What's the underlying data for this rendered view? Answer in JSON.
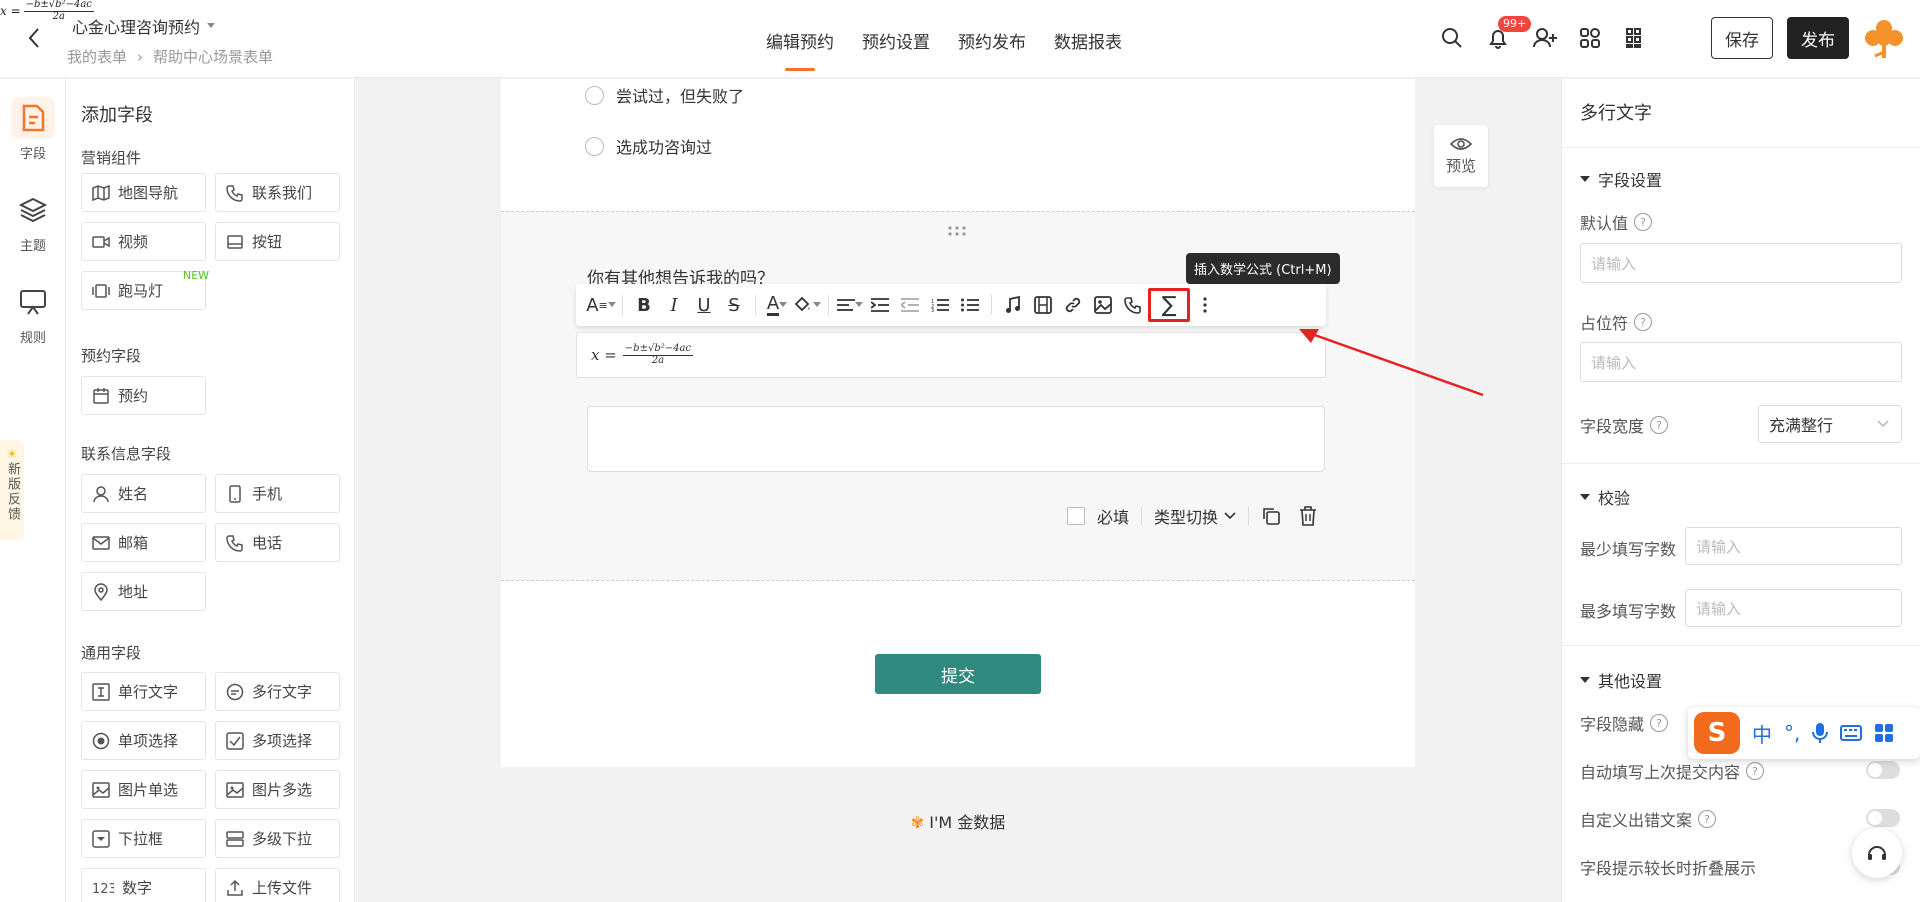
{
  "header": {
    "formula": {
      "lhs": "x =",
      "num": "−b±√b²−4ac",
      "den": "2a"
    },
    "title": "心金心理咨询预约",
    "breadcrumb": [
      "我的表单",
      "帮助中心场景表单"
    ],
    "tabs": [
      {
        "label": "编辑预约",
        "active": true
      },
      {
        "label": "预约设置",
        "active": false
      },
      {
        "label": "预约发布",
        "active": false
      },
      {
        "label": "数据报表",
        "active": false
      }
    ],
    "notification_badge": "99+",
    "save_label": "保存",
    "publish_label": "发布"
  },
  "rail": {
    "items": [
      {
        "label": "字段",
        "icon": "field-icon",
        "active": true
      },
      {
        "label": "主题",
        "icon": "theme-icon",
        "active": false
      },
      {
        "label": "规则",
        "icon": "rule-icon",
        "active": false
      }
    ],
    "feedback": "新版反馈"
  },
  "fields_panel": {
    "title": "添加字段",
    "sections": [
      {
        "name": "营销组件",
        "items": [
          "地图导航",
          "联系我们",
          "视频",
          "按钮",
          "跑马灯"
        ]
      },
      {
        "name": "预约字段",
        "items": [
          "预约"
        ]
      },
      {
        "name": "联系信息字段",
        "items": [
          "姓名",
          "手机",
          "邮箱",
          "电话",
          "地址"
        ]
      },
      {
        "name": "通用字段",
        "items": [
          "单行文字",
          "多行文字",
          "单项选择",
          "多项选择",
          "图片单选",
          "图片多选",
          "下拉框",
          "多级下拉",
          "数字",
          "上传文件"
        ]
      }
    ],
    "new_tag": "NEW"
  },
  "canvas": {
    "options": [
      "尝试过，但失败了",
      "选成功咨询过"
    ],
    "question": "你有其他想告诉我的吗？",
    "tooltip": "插入数学公式 (Ctrl+M)",
    "required_label": "必填",
    "type_switch_label": "类型切换",
    "submit_label": "提交",
    "brand": "I'M 金数据",
    "preview_label": "预览",
    "math": {
      "lhs": "x =",
      "num": "−b±√b²−4ac",
      "den": "2a"
    }
  },
  "props_panel": {
    "title": "多行文字",
    "field_settings": "字段设置",
    "default_value_label": "默认值",
    "default_value_placeholder": "请输入",
    "placeholder_label": "占位符",
    "placeholder_placeholder": "请输入",
    "width_label": "字段宽度",
    "width_value": "充满整行",
    "validation": "校验",
    "min_label": "最少填写字数",
    "min_placeholder": "请输入",
    "max_label": "最多填写字数",
    "max_placeholder": "请输入",
    "other_settings": "其他设置",
    "toggles": [
      "字段隐藏",
      "自动填写上次提交内容",
      "自定义出错文案",
      "字段提示较长时折叠展示"
    ]
  },
  "ime": {
    "logo": "S",
    "mode": "中",
    "punct": "°,"
  },
  "colors": {
    "accent": "#f4752a",
    "submit": "#308a80",
    "highlight": "#e52222"
  }
}
